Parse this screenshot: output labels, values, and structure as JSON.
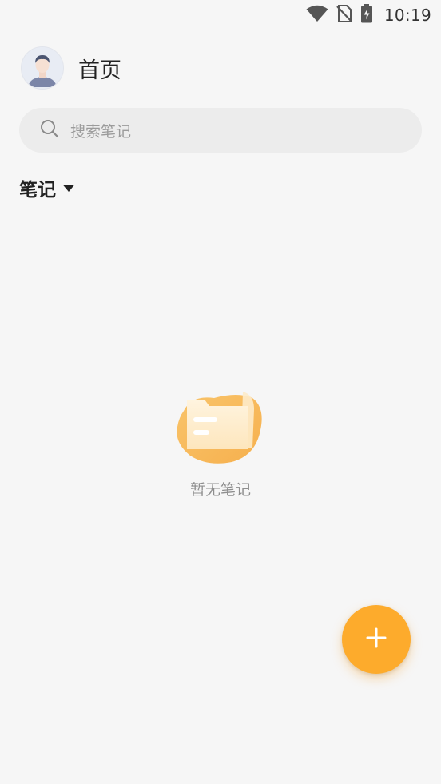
{
  "status_bar": {
    "time": "10:19",
    "icons": [
      "wifi-icon",
      "no-sim-icon",
      "battery-charging-icon"
    ]
  },
  "header": {
    "avatar": "user-avatar",
    "title": "首页"
  },
  "search": {
    "placeholder": "搜索笔记",
    "icon": "search-icon"
  },
  "filter": {
    "label": "笔记",
    "icon": "caret-down-icon"
  },
  "empty_state": {
    "icon": "empty-folder-illustration",
    "text": "暂无笔记"
  },
  "fab": {
    "icon": "plus-icon"
  },
  "colors": {
    "accent": "#fdab2c",
    "background": "#f6f6f6",
    "search_bg": "#ececec"
  }
}
